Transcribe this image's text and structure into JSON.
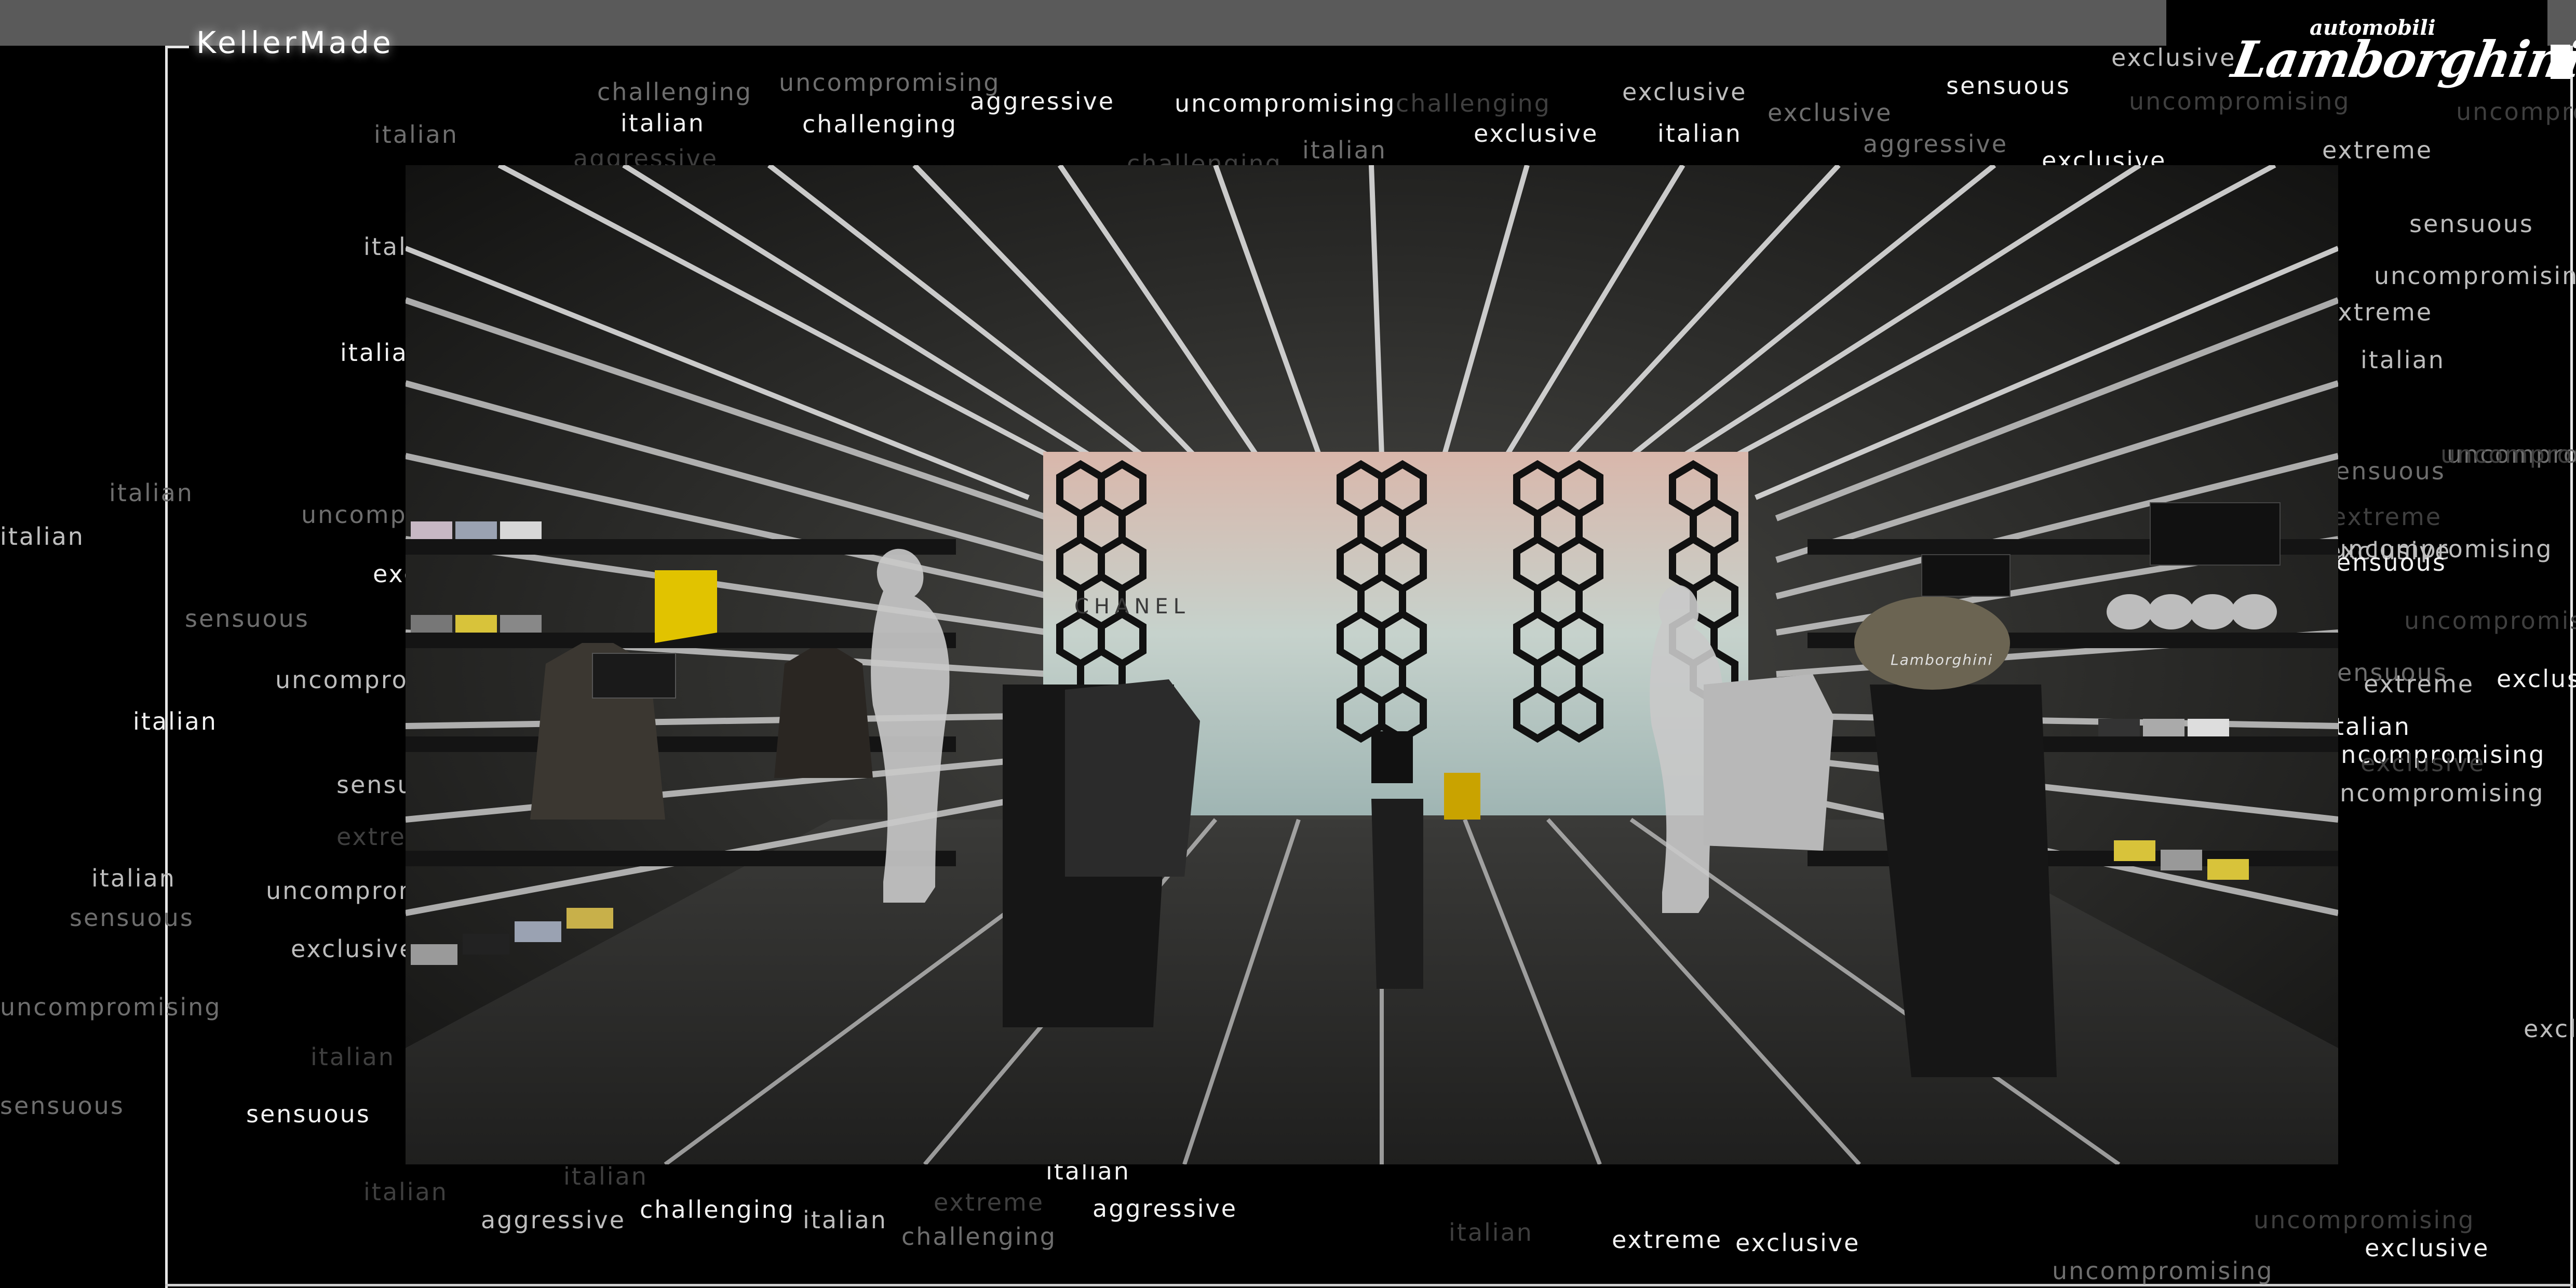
{
  "brand": {
    "studio": "KellerMade",
    "logo_top": "automobili",
    "logo_main": "Lamborghini"
  },
  "hero": {
    "storefront_sign": "CHANEL",
    "bag_label": "Lamborghini"
  },
  "words": [
    "challenging",
    "uncompromising",
    "italian",
    "challenging",
    "aggressive",
    "uncompromising",
    "challenging",
    "exclusive",
    "exclusive",
    "italian",
    "exclusive",
    "sensuous",
    "exclusive",
    "uncompromising",
    "uncompromising",
    "aggressive",
    "aggressive",
    "challenging",
    "italian",
    "italian",
    "exclusive",
    "extreme",
    "sensuous",
    "uncompromising",
    "italian",
    "uncompromising",
    "italian",
    "italian",
    "italian",
    "uncompromising",
    "exclusive",
    "sensuous",
    "uncompromising",
    "italian",
    "sensuous",
    "uncompromising",
    "extreme",
    "uncompromising",
    "italian",
    "sensuous",
    "extreme",
    "italian",
    "sensuous",
    "uncompromising",
    "exclusive",
    "uncompromising",
    "italian",
    "sensuous",
    "sensuous",
    "italian",
    "aggressive",
    "challenging",
    "italian",
    "challenging",
    "extreme",
    "aggressive",
    "italian",
    "italian",
    "italian",
    "extreme",
    "exclusive",
    "uncompromising",
    "uncompromising",
    "exclusive",
    "sensuous",
    "uncompromising",
    "extreme",
    "exclusive",
    "italian",
    "exclusive",
    "exclusive",
    "uncompromising",
    "italian",
    "exclusive",
    "sensuous",
    "uncompromising",
    "extreme"
  ]
}
